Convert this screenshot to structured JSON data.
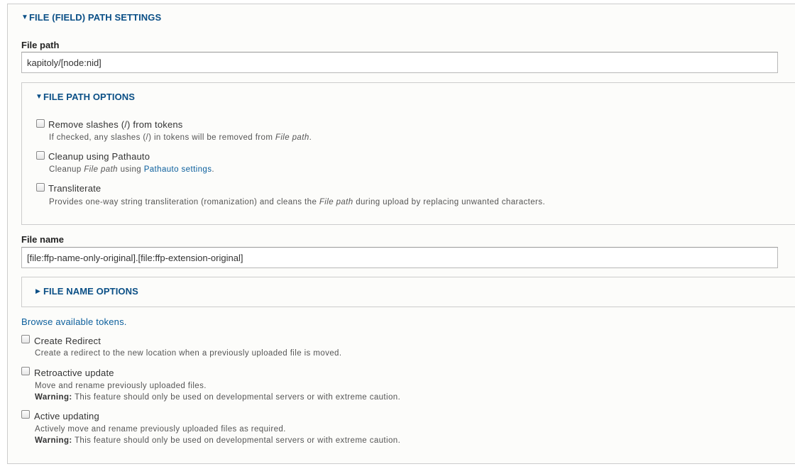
{
  "path_settings": {
    "title": "FILE (FIELD) PATH SETTINGS",
    "file_path": {
      "label": "File path",
      "value": "kapitoly/[node:nid]"
    },
    "path_options": {
      "title": "FILE PATH OPTIONS",
      "remove_slashes": {
        "label": "Remove slashes (/) from tokens",
        "desc_before": "If checked, any slashes (/) in tokens will be removed from",
        "desc_em": "File path",
        "desc_after": "."
      },
      "pathauto": {
        "label": "Cleanup using Pathauto",
        "desc_before": "Cleanup",
        "desc_em": "File path",
        "desc_mid": "using",
        "desc_link": "Pathauto settings",
        "desc_after": "."
      },
      "transliterate": {
        "label": "Transliterate",
        "desc_before": "Provides one-way string transliteration (romanization) and cleans the",
        "desc_em": "File path",
        "desc_after": "during upload by replacing unwanted characters."
      }
    },
    "file_name": {
      "label": "File name",
      "value": "[file:ffp-name-only-original].[file:ffp-extension-original]"
    },
    "name_options": {
      "title": "FILE NAME OPTIONS"
    },
    "browse_tokens": "Browse available tokens.",
    "create_redirect": {
      "label": "Create Redirect",
      "desc": "Create a redirect to the new location when a previously uploaded file is moved."
    },
    "retroactive": {
      "label": "Retroactive update",
      "desc": "Move and rename previously uploaded files.",
      "warning_label": "Warning:",
      "warning_text": "This feature should only be used on developmental servers or with extreme caution."
    },
    "active": {
      "label": "Active updating",
      "desc": "Actively move and rename previously uploaded files as required.",
      "warning_label": "Warning:",
      "warning_text": "This feature should only be used on developmental servers or with extreme caution."
    },
    "icons": {
      "expanded": "▼",
      "collapsed": "▶"
    }
  }
}
